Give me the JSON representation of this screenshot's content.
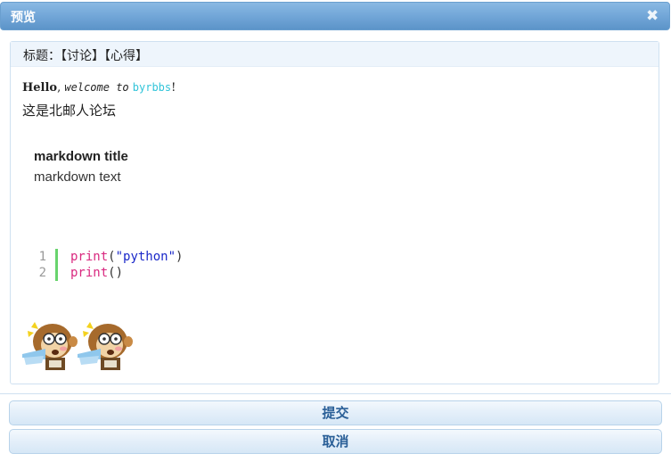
{
  "dialog": {
    "title": "预览",
    "close_glyph": "✖"
  },
  "preview": {
    "subject_label": "标题：",
    "subject_value": "【讨论】【心得】",
    "line1": {
      "hello": "Hello",
      "sep": ",",
      "welcome": "welcome to",
      "link": "byrbbs",
      "exclaim": "!"
    },
    "line2": "这是北邮人论坛",
    "markdown_title": "markdown title",
    "markdown_text": "markdown text",
    "code": [
      {
        "num": "1",
        "fn": "print",
        "open": "(",
        "str": "\"python\"",
        "close": ")"
      },
      {
        "num": "2",
        "fn": "print",
        "open": "(",
        "str": "",
        "close": ")"
      }
    ],
    "emojis": [
      "monkey-emoji",
      "monkey-emoji"
    ]
  },
  "buttons": {
    "submit": "提交",
    "cancel": "取消"
  },
  "colors": {
    "titlebar": "#74a8d9",
    "link": "#31c4d9",
    "code_keyword": "#d9287f",
    "code_string": "#1a28c9",
    "code_bar": "#68d46d",
    "button_text": "#2a5f97"
  }
}
